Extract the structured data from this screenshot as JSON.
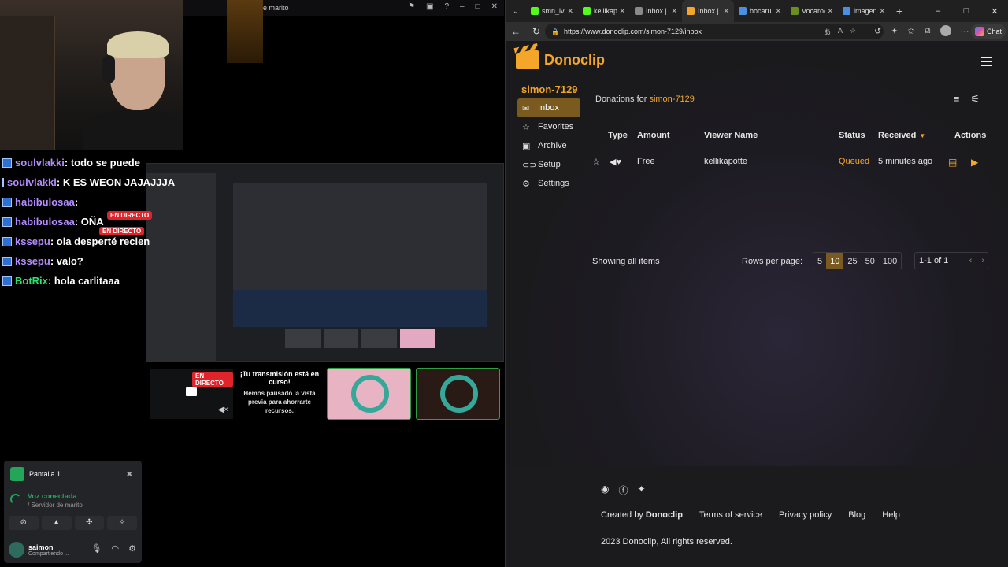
{
  "stream": {
    "discord_title": "e marito",
    "chat": [
      {
        "user": "soulvlakki",
        "msg": " : todo se puede"
      },
      {
        "user": "soulvlakki",
        "msg": " : K ES WEON JAJAJJJA"
      },
      {
        "user": "habibulosaa",
        "msg": " :"
      },
      {
        "user": "habibulosaa",
        "msg": " : OÑA"
      },
      {
        "user": "kssepu",
        "msg": " : ola desperté recien"
      },
      {
        "user": "kssepu",
        "msg": " : valo?"
      },
      {
        "user": "BotRix",
        "msg": " : hola carlitaaa"
      }
    ],
    "live_badge": "EN DIRECTO",
    "paused_title": "¡Tu transmisión está en curso!",
    "paused_desc": "Hemos pausado la vista previa para ahorrarte recursos.",
    "voice": {
      "screen_label": "Pantalla 1",
      "connected": "Voz conectada",
      "server": "/ Servidor de marito",
      "username": "saimon",
      "user_status": "Compartiendo ..."
    }
  },
  "browser": {
    "tabs": [
      {
        "label": "smn_iv",
        "color": "#53fc18"
      },
      {
        "label": "kellikap",
        "color": "#53fc18"
      },
      {
        "label": "Inbox |",
        "color": "#8a8a8a"
      },
      {
        "label": "Inbox |",
        "color": "#f4a62a"
      },
      {
        "label": "bocaru",
        "color": "#4a90e2"
      },
      {
        "label": "Vocaroc",
        "color": "#6b8e23"
      },
      {
        "label": "imagen",
        "color": "#4a90e2"
      }
    ],
    "url": "https://www.donoclip.com/simon-7129/inbox",
    "chat_label": "Chat"
  },
  "donoclip": {
    "brand": "Donoclip",
    "username": "simon-7129",
    "nav": [
      {
        "label": "Inbox",
        "icon": "inbox-icon",
        "glyph": "✉"
      },
      {
        "label": "Favorites",
        "icon": "star-icon",
        "glyph": "☆"
      },
      {
        "label": "Archive",
        "icon": "archive-icon",
        "glyph": "▣"
      },
      {
        "label": "Setup",
        "icon": "link-icon",
        "glyph": "⊂⊃"
      },
      {
        "label": "Settings",
        "icon": "gear-icon",
        "glyph": "⚙"
      }
    ],
    "donations_for": "Donations for",
    "columns": {
      "type": "Type",
      "amount": "Amount",
      "viewer": "Viewer Name",
      "status": "Status",
      "received": "Received",
      "actions": "Actions"
    },
    "rows": [
      {
        "amount": "Free",
        "viewer": "kellikapotte",
        "status": "Queued",
        "received": "5 minutes ago"
      }
    ],
    "showing": "Showing all items",
    "rows_per_page_label": "Rows per page:",
    "rows_options": [
      "5",
      "10",
      "25",
      "50",
      "100"
    ],
    "rows_selected": "10",
    "page_range": "1-1 of 1",
    "footer": {
      "created_by": "Created by",
      "brand": "Donoclip",
      "links": [
        "Terms of service",
        "Privacy policy",
        "Blog",
        "Help"
      ],
      "copyright": "2023 Donoclip, All rights reserved."
    }
  }
}
